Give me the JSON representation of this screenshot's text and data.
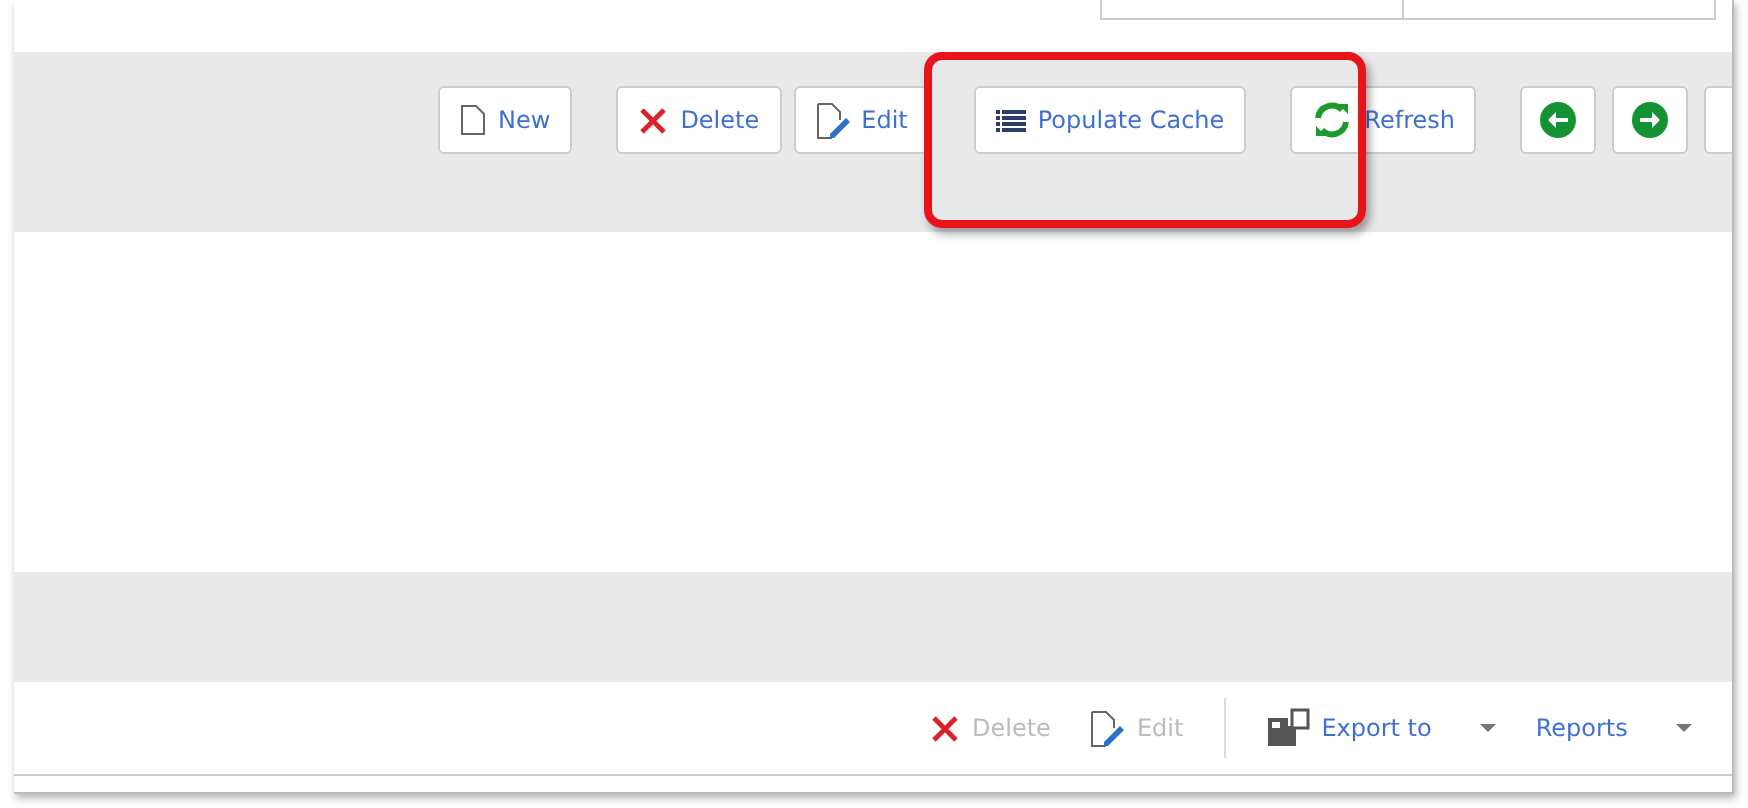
{
  "top_toolbar": {
    "buttons": [
      {
        "kind": "new",
        "label": "New",
        "disabled": false
      },
      {
        "kind": "delete",
        "label": "Delete",
        "disabled": false
      },
      {
        "kind": "edit",
        "label": "Edit",
        "disabled": false
      },
      {
        "kind": "list",
        "label": "Populate Cache",
        "disabled": false
      },
      {
        "kind": "refresh",
        "label": "Refresh",
        "disabled": false
      },
      {
        "kind": "back"
      },
      {
        "kind": "forward"
      }
    ]
  },
  "bottom_toolbar": {
    "buttons": [
      {
        "kind": "delete",
        "label": "Delete",
        "disabled": true,
        "dropdown": false
      },
      {
        "kind": "edit",
        "label": "Edit",
        "disabled": true,
        "dropdown": false
      },
      {
        "kind": "export",
        "label": "Export to",
        "disabled": false,
        "dropdown": true
      },
      {
        "kind": "none",
        "label": "Reports",
        "disabled": false,
        "dropdown": true
      }
    ]
  }
}
